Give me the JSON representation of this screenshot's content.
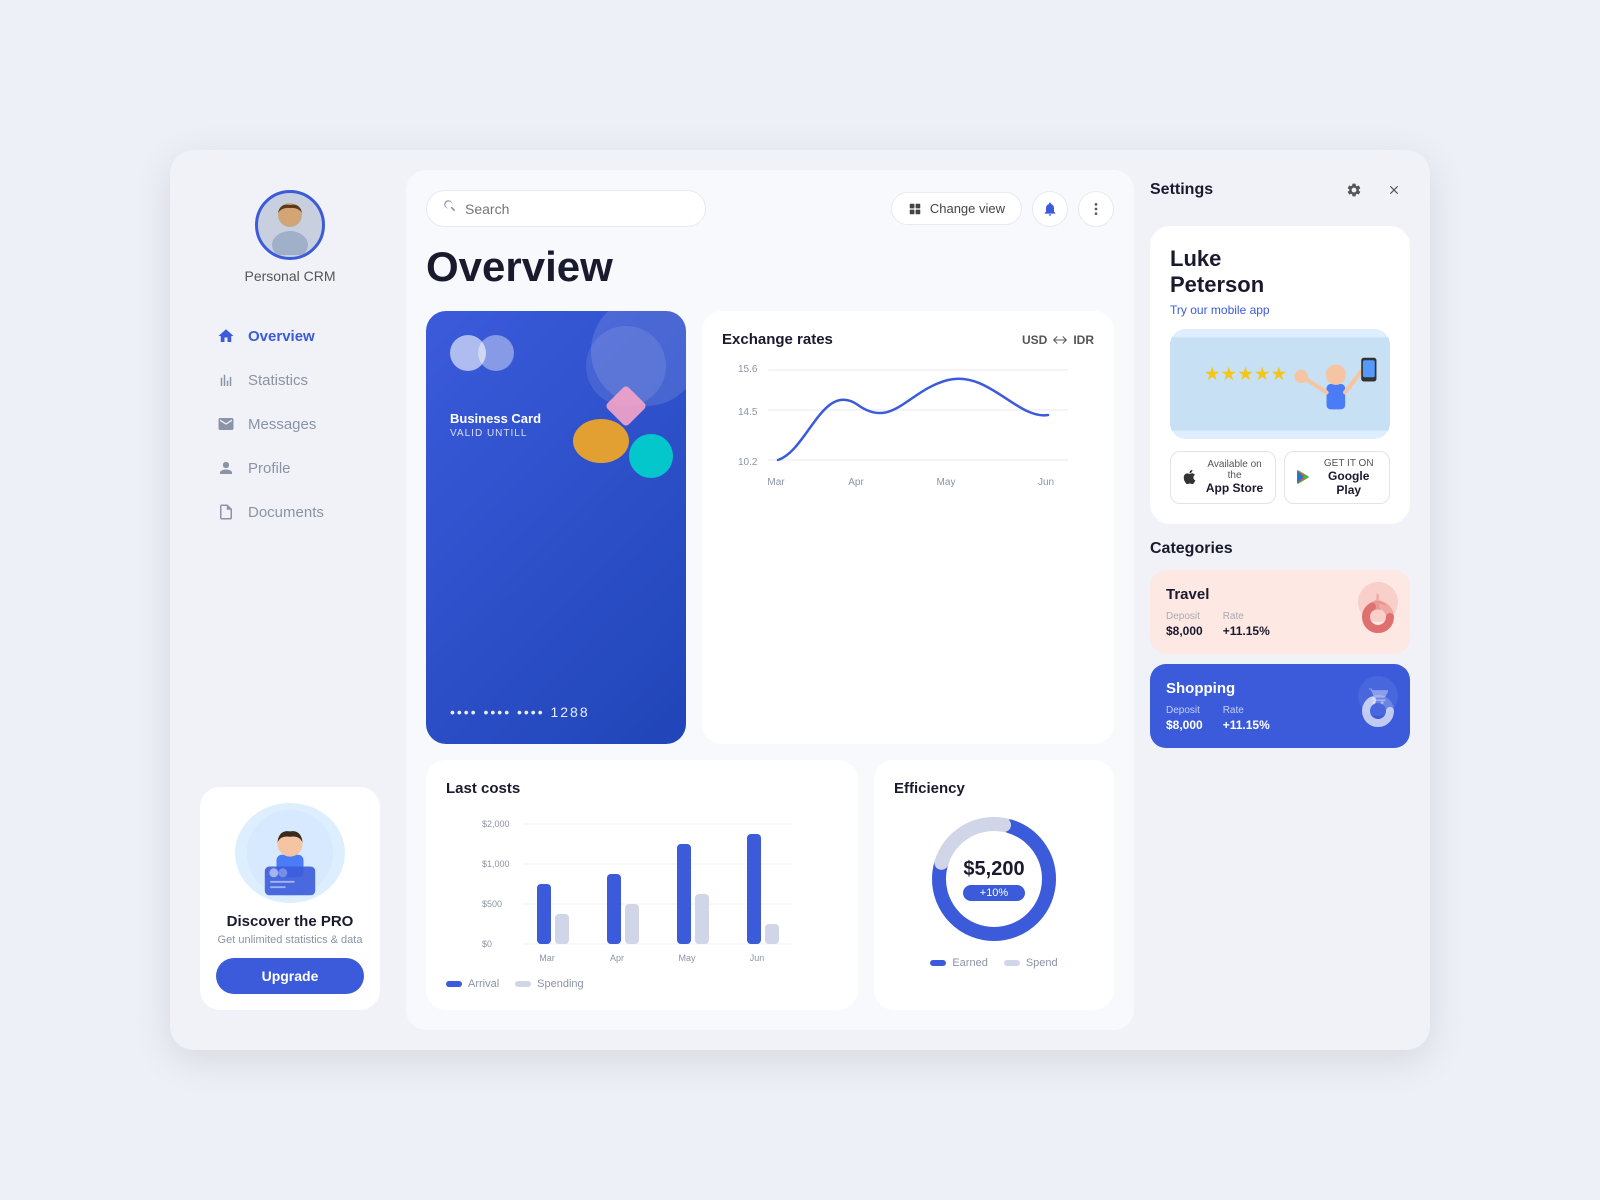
{
  "app": {
    "brand": "Personal CRM"
  },
  "sidebar": {
    "nav_items": [
      {
        "label": "Overview",
        "icon": "home-icon",
        "active": true
      },
      {
        "label": "Statistics",
        "icon": "stats-icon",
        "active": false
      },
      {
        "label": "Messages",
        "icon": "message-icon",
        "active": false
      },
      {
        "label": "Profile",
        "icon": "profile-icon",
        "active": false
      },
      {
        "label": "Documents",
        "icon": "document-icon",
        "active": false
      }
    ],
    "promo": {
      "title": "Discover the PRO",
      "subtitle": "Get unlimited statistics & data",
      "button": "Upgrade"
    }
  },
  "main": {
    "search_placeholder": "Search",
    "change_view_label": "Change view",
    "page_title": "Overview",
    "credit_card": {
      "label": "Business Card",
      "valid_label": "VALID UNTILL",
      "number": "•••• ••••  •••• 1288"
    },
    "exchange": {
      "title": "Exchange rates",
      "from": "USD",
      "to": "IDR",
      "y_labels": [
        "15.6",
        "14.5",
        "10.2"
      ],
      "x_labels": [
        "Mar",
        "Apr",
        "May",
        "Jun"
      ]
    },
    "last_costs": {
      "title": "Last costs",
      "y_labels": [
        "$2,000",
        "$1,000",
        "$500",
        "$0"
      ],
      "x_labels": [
        "Mar",
        "Apr",
        "May",
        "Jun"
      ],
      "legend_arrival": "Arrival",
      "legend_spending": "Spending"
    },
    "efficiency": {
      "title": "Efficiency",
      "amount": "$5,200",
      "percent": "+10%",
      "legend_earned": "Earned",
      "legend_spend": "Spend"
    }
  },
  "right_panel": {
    "settings_label": "Settings",
    "user": {
      "name": "Luke\nPeterson",
      "cta": "Try our mobile app"
    },
    "stores": {
      "appstore_small": "Available on the",
      "appstore": "App Store",
      "googleplay_small": "GET IT ON",
      "googleplay": "Google Play"
    },
    "categories": {
      "title": "Categories",
      "items": [
        {
          "name": "Travel",
          "deposit_label": "Deposit",
          "deposit": "$8,000",
          "rate_label": "Rate",
          "rate": "+11.15%",
          "theme": "pink"
        },
        {
          "name": "Shopping",
          "deposit_label": "Deposit",
          "deposit": "$8,000",
          "rate_label": "Rate",
          "rate": "+11.15%",
          "theme": "blue"
        }
      ]
    }
  }
}
